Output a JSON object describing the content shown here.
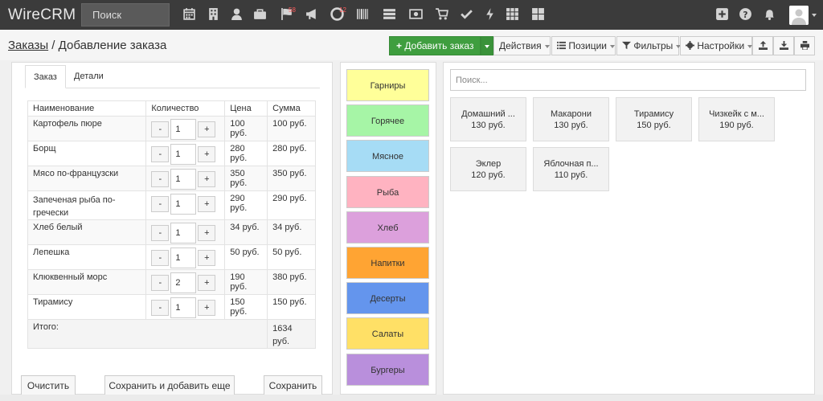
{
  "app": {
    "brand": "WireCRM",
    "search_placeholder": "Поиск"
  },
  "topbar_icons": [
    {
      "name": "calendar-icon",
      "badge": ""
    },
    {
      "name": "building-icon",
      "badge": ""
    },
    {
      "name": "user-icon",
      "badge": ""
    },
    {
      "name": "briefcase-icon",
      "badge": ""
    },
    {
      "name": "flag-icon",
      "badge": "58"
    },
    {
      "name": "bullhorn-icon",
      "badge": ""
    },
    {
      "name": "support-icon",
      "badge": "12"
    },
    {
      "name": "barcode-icon",
      "badge": ""
    },
    {
      "name": "list-icon",
      "badge": ""
    },
    {
      "name": "money-icon",
      "badge": ""
    },
    {
      "name": "cart-icon",
      "badge": ""
    },
    {
      "name": "check-icon",
      "badge": ""
    },
    {
      "name": "bolt-icon",
      "badge": ""
    },
    {
      "name": "grid-icon",
      "badge": ""
    },
    {
      "name": "dashboard-icon",
      "badge": ""
    }
  ],
  "topbar_right_icons": [
    "plus-square-icon",
    "question-icon",
    "bell-icon",
    "avatar"
  ],
  "breadcrumb": {
    "parent": "Заказы",
    "separator": " / ",
    "current": "Добавление заказа"
  },
  "toolbar": {
    "add_order": "Добавить заказ",
    "actions": "Действия",
    "positions": "Позиции",
    "filters": "Фильтры",
    "settings": "Настройки"
  },
  "tabs": [
    "Заказ",
    "Детали"
  ],
  "order_table": {
    "headers": [
      "Наименование",
      "Количество",
      "Цена",
      "Сумма"
    ],
    "rows": [
      {
        "name": "Картофель пюре",
        "qty": "1",
        "price": "100 руб.",
        "sum": "100 руб."
      },
      {
        "name": "Борщ",
        "qty": "1",
        "price": "280 руб.",
        "sum": "280 руб."
      },
      {
        "name": "Мясо по-французски",
        "qty": "1",
        "price": "350 руб.",
        "sum": "350 руб."
      },
      {
        "name": "Запеченая рыба по-гречески",
        "qty": "1",
        "price": "290 руб.",
        "sum": "290 руб."
      },
      {
        "name": "Хлеб белый",
        "qty": "1",
        "price": "34 руб.",
        "sum": "34 руб."
      },
      {
        "name": "Лепешка",
        "qty": "1",
        "price": "50 руб.",
        "sum": "50 руб."
      },
      {
        "name": "Клюквенный морс",
        "qty": "2",
        "price": "190 руб.",
        "sum": "380 руб."
      },
      {
        "name": "Тирамису",
        "qty": "1",
        "price": "150 руб.",
        "sum": "150 руб."
      }
    ],
    "minus": "-",
    "plus": "+",
    "total_label": "Итого:",
    "total_value": "1634 руб."
  },
  "bottom_buttons": {
    "clear": "Очистить",
    "save_add": "Сохранить и добавить еще",
    "save": "Сохранить"
  },
  "categories": [
    {
      "label": "Гарниры",
      "color": "#ffff99"
    },
    {
      "label": "Горячее",
      "color": "#a6f5a6"
    },
    {
      "label": "Мясное",
      "color": "#a6dcf5"
    },
    {
      "label": "Рыба",
      "color": "#ffb3c1"
    },
    {
      "label": "Хлеб",
      "color": "#dca0dc"
    },
    {
      "label": "Напитки",
      "color": "#ffa433"
    },
    {
      "label": "Десерты",
      "color": "#6495ed"
    },
    {
      "label": "Салаты",
      "color": "#ffe066"
    },
    {
      "label": "Бургеры",
      "color": "#b98fdc"
    }
  ],
  "products_search_placeholder": "Поиск...",
  "products": [
    {
      "name": "Домашний ...",
      "price": "130 руб."
    },
    {
      "name": "Макарони",
      "price": "130 руб."
    },
    {
      "name": "Тирамису",
      "price": "150 руб."
    },
    {
      "name": "Чизкейк с м...",
      "price": "190 руб."
    },
    {
      "name": "Эклер",
      "price": "120 руб."
    },
    {
      "name": "Яблочная п...",
      "price": "110 руб."
    }
  ]
}
